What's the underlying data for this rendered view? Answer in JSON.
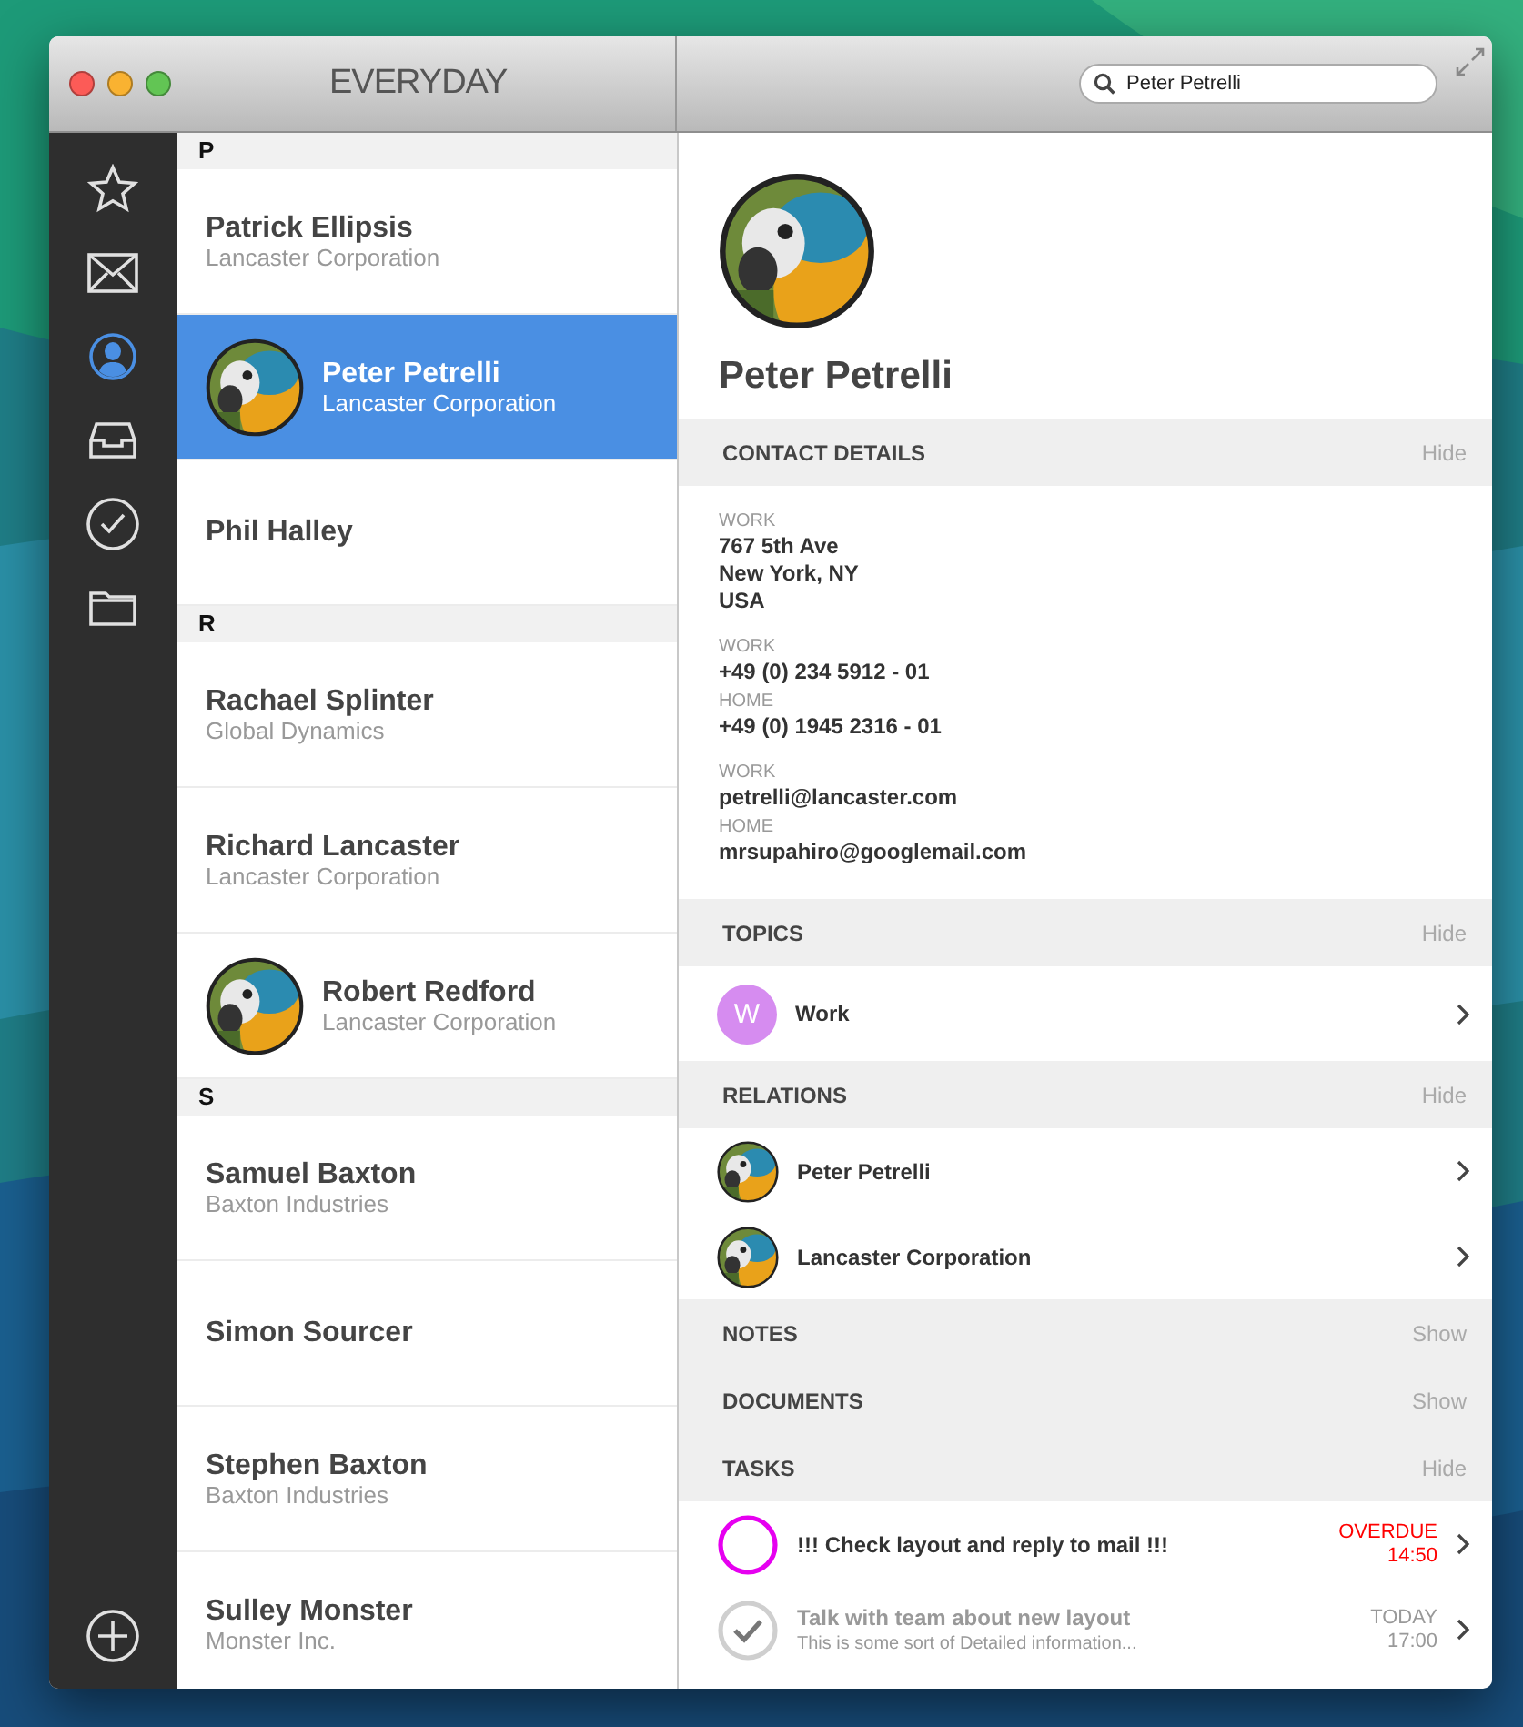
{
  "window": {
    "title": "EVERYDAY"
  },
  "search": {
    "value": "Peter Petrelli"
  },
  "sidebar": {
    "items": [
      {
        "kind": "star",
        "selected": false
      },
      {
        "kind": "mail",
        "selected": false
      },
      {
        "kind": "person",
        "selected": true
      },
      {
        "kind": "inbox",
        "selected": false
      },
      {
        "kind": "check",
        "selected": false
      },
      {
        "kind": "folder",
        "selected": false
      }
    ]
  },
  "contacts": [
    {
      "letter": "P",
      "people": [
        {
          "name": "Patrick Ellipsis",
          "company": "Lancaster Corporation",
          "selected": false
        },
        {
          "name": "Peter Petrelli",
          "company": "Lancaster Corporation",
          "selected": true
        },
        {
          "name": "Phil Halley",
          "selected": false
        }
      ]
    },
    {
      "letter": "R",
      "people": [
        {
          "name": "Rachael Splinter",
          "company": "Global Dynamics",
          "selected": false
        },
        {
          "name": "Richard Lancaster",
          "company": "Lancaster Corporation",
          "selected": false
        },
        {
          "name": "Robert Redford",
          "company": "Lancaster Corporation",
          "selected": false
        }
      ]
    },
    {
      "letter": "S",
      "people": [
        {
          "name": "Samuel Baxton",
          "company": "Baxton Industries",
          "selected": false
        },
        {
          "name": "Simon Sourcer",
          "selected": false
        },
        {
          "name": "Stephen Baxton",
          "company": "Baxton Industries",
          "selected": false
        },
        {
          "name": "Sulley Monster",
          "company": "Monster Inc.",
          "selected": false
        }
      ]
    }
  ],
  "detail": {
    "name": "Peter Petrelli",
    "contact_details": {
      "title": "CONTACT DETAILS",
      "action": "Hide",
      "groups": [
        [
          {
            "label": "WORK",
            "lines": [
              "767 5th Ave",
              "New York, NY",
              "USA"
            ]
          }
        ],
        [
          {
            "label": "WORK",
            "lines": [
              "+49 (0) 234 5912 - 01"
            ]
          },
          {
            "label": "HOME",
            "lines": [
              "+49 (0) 1945 2316 - 01"
            ]
          }
        ],
        [
          {
            "label": "WORK",
            "lines": [
              "petrelli@lancaster.com"
            ]
          },
          {
            "label": "HOME",
            "lines": [
              "mrsupahiro@googlemail.com"
            ]
          }
        ]
      ]
    },
    "topics": {
      "title": "TOPICS",
      "action": "Hide",
      "items": [
        {
          "initial": "W",
          "label": "Work",
          "color": "#d68cf0"
        }
      ]
    },
    "relations": {
      "title": "RELATIONS",
      "action": "Hide",
      "items": [
        {
          "label": "Peter Petrelli"
        },
        {
          "label": "Lancaster Corporation"
        }
      ]
    },
    "notes": {
      "title": "NOTES",
      "action": "Show"
    },
    "documents": {
      "title": "DOCUMENTS",
      "action": "Show"
    },
    "tasks": {
      "title": "TASKS",
      "action": "Hide",
      "items": [
        {
          "title": "!!! Check layout and reply to mail !!!",
          "done": false,
          "overdue": true,
          "due": "OVERDUE",
          "time": "14:50"
        },
        {
          "title": "Talk with team about new layout",
          "detail": "This is some sort of Detailed information...",
          "done": true,
          "overdue": false,
          "due": "TODAY",
          "time": "17:00"
        }
      ]
    }
  }
}
